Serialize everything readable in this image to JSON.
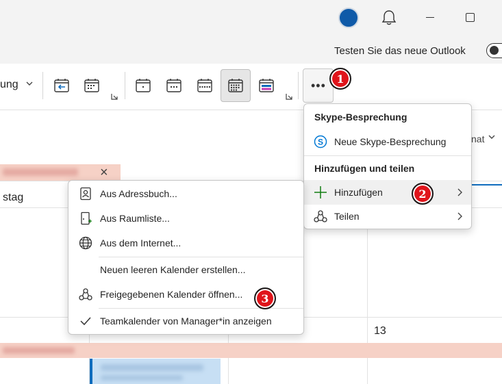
{
  "header": {
    "preview_toggle_label": "Testen Sie das neue Outlook"
  },
  "ribbon": {
    "partial_label": "ung",
    "more_button_dots": "•••"
  },
  "calendar": {
    "week_label": "stag",
    "format_partial": "nat",
    "day_number": "13"
  },
  "more_menu": {
    "section1_title": "Skype-Besprechung",
    "skype_item": "Neue Skype-Besprechung",
    "section2_title": "Hinzufügen und teilen",
    "add_item": "Hinzufügen",
    "share_item": "Teilen"
  },
  "add_menu": {
    "items": [
      "Aus Adressbuch...",
      "Aus Raumliste...",
      "Aus dem Internet...",
      "Neuen leeren Kalender erstellen...",
      "Freigegebenen Kalender öffnen...",
      "Teamkalender von Manager*in anzeigen"
    ]
  },
  "steps": [
    "1",
    "2",
    "3"
  ],
  "colors": {
    "accent": "#0f6cbd",
    "badge": "#e0141b",
    "event_pink": "#f6d1c6",
    "event_blue": "#c7dff4"
  },
  "icons": {
    "bell": "bell-icon",
    "calendar_views": [
      "calendar-back-icon",
      "calendar-week-icon",
      "calendar-day-icon",
      "calendar-workweek-icon",
      "calendar-week5-icon",
      "calendar-month-icon",
      "calendar-board-icon"
    ],
    "skype": "skype-icon",
    "add": "plus-icon",
    "share": "share-icon",
    "address_book": "address-book-icon",
    "room_list": "room-list-icon",
    "internet": "globe-icon",
    "shared_calendar": "share-icon",
    "check": "check-icon"
  }
}
